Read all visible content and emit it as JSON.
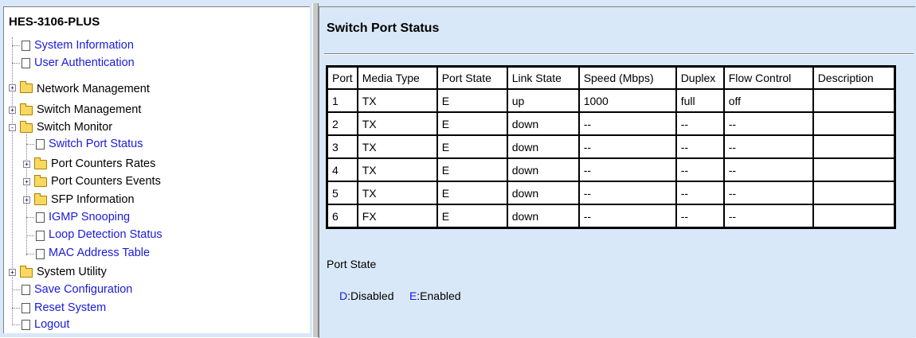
{
  "sidebar": {
    "title": "HES-3106-PLUS",
    "items": [
      {
        "label": "System Information"
      },
      {
        "label": "User Authentication"
      },
      {
        "label": "Network Management"
      },
      {
        "label": "Switch Management"
      },
      {
        "label": "Switch Monitor"
      },
      {
        "label": "Switch Port Status"
      },
      {
        "label": "Port Counters Rates"
      },
      {
        "label": "Port Counters Events"
      },
      {
        "label": "SFP Information"
      },
      {
        "label": "IGMP Snooping"
      },
      {
        "label": "Loop Detection Status"
      },
      {
        "label": "MAC Address Table"
      },
      {
        "label": "System Utility"
      },
      {
        "label": "Save Configuration"
      },
      {
        "label": "Reset System"
      },
      {
        "label": "Logout"
      }
    ]
  },
  "main": {
    "title": "Switch Port Status",
    "table": {
      "headers": [
        "Port",
        "Media Type",
        "Port State",
        "Link State",
        "Speed (Mbps)",
        "Duplex",
        "Flow Control",
        "Description"
      ],
      "rows": [
        [
          "1",
          "TX",
          "E",
          "up",
          "1000",
          "full",
          "off",
          ""
        ],
        [
          "2",
          "TX",
          "E",
          "down",
          "--",
          "--",
          "--",
          ""
        ],
        [
          "3",
          "TX",
          "E",
          "down",
          "--",
          "--",
          "--",
          ""
        ],
        [
          "4",
          "TX",
          "E",
          "down",
          "--",
          "--",
          "--",
          ""
        ],
        [
          "5",
          "TX",
          "E",
          "down",
          "--",
          "--",
          "--",
          ""
        ],
        [
          "6",
          "FX",
          "E",
          "down",
          "--",
          "--",
          "--",
          ""
        ]
      ]
    },
    "legend": {
      "title": "Port State",
      "d_code": "D",
      "d_text": ":Disabled",
      "e_code": "E",
      "e_text": ":Enabled"
    }
  },
  "colors": {
    "link": "#1a1adc",
    "content_bg": "#d8e8f8"
  }
}
